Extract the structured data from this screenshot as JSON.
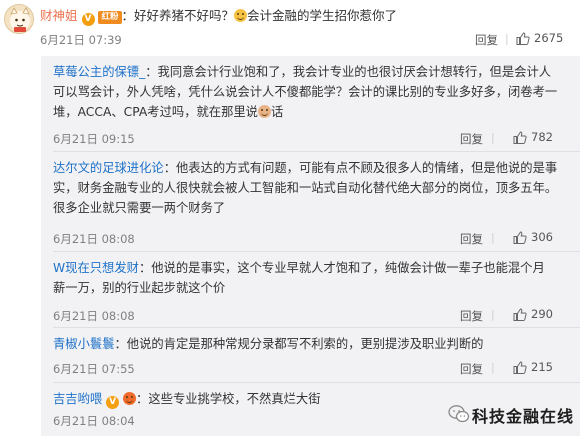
{
  "main_comment": {
    "username": "财神姐",
    "badge_tag": "红粉",
    "text_before_mention": "：好好养猪不好吗？",
    "text_after_mention": "会计金融的学生招你惹你了",
    "time": "6月21日 07:39",
    "reply_label": "回复",
    "like_count": "2675"
  },
  "replies": [
    {
      "username": "草莓公主的保镖_",
      "lines": [
        "：我同意会计行业饱和了，我会计专业的也很讨厌会计想转行，但是会计人",
        "可以骂会计，外人凭啥，凭什么说会计人不傻都能学？会计的课比别的专业多好多，闭卷考一",
        "堆，ACCA、CPA考过吗，就在那里说",
        "话"
      ],
      "time": "6月21日 09:15",
      "reply_label": "回复",
      "like_count": "782"
    },
    {
      "username": "达尔文的足球进化论",
      "lines": [
        "：他表达的方式有问题，可能有点不顾及很多人的情绪，但是他说的是事",
        "实，财务金融专业的人很快就会被人工智能和一站式自动化替代绝大部分的岗位，顶多五年。",
        "很多企业就只需要一两个财务了"
      ],
      "time": "6月21日 08:08",
      "reply_label": "回复",
      "like_count": "306"
    },
    {
      "username": "W现在只想发财",
      "lines": [
        "：他说的是事实，这个专业早就人才饱和了，纯做会计做一辈子也能混个月",
        "薪一万，别的行业起步就这个价"
      ],
      "time": "6月21日 08:08",
      "reply_label": "回复",
      "like_count": "290"
    },
    {
      "username": "青椒小鬟鬟",
      "lines": [
        "：他说的肯定是那种常规分录都写不利索的，更别提涉及职业判断的"
      ],
      "time": "6月21日 07:55",
      "reply_label": "回复",
      "like_count": "215"
    },
    {
      "username": "吉吉哟喂",
      "lines": [
        "：这些专业挑学校，不然真烂大街"
      ],
      "time": "6月21日 08:04",
      "reply_label": "回复",
      "like_count": ""
    }
  ],
  "watermark": {
    "text": "科技金融在线"
  },
  "colors": {
    "username_main": "#eb7350",
    "username_reply": "#1f72c8",
    "panel_bg": "#f2f2f5",
    "like_icon": "#666666"
  },
  "icons": [
    "avatar-cat",
    "verified-badge-icon",
    "fan-tag",
    "grin-emoji-icon",
    "person-emoji-icon",
    "fire-emoji-icon",
    "thumbs-up-icon",
    "wechat-logo-icon"
  ]
}
